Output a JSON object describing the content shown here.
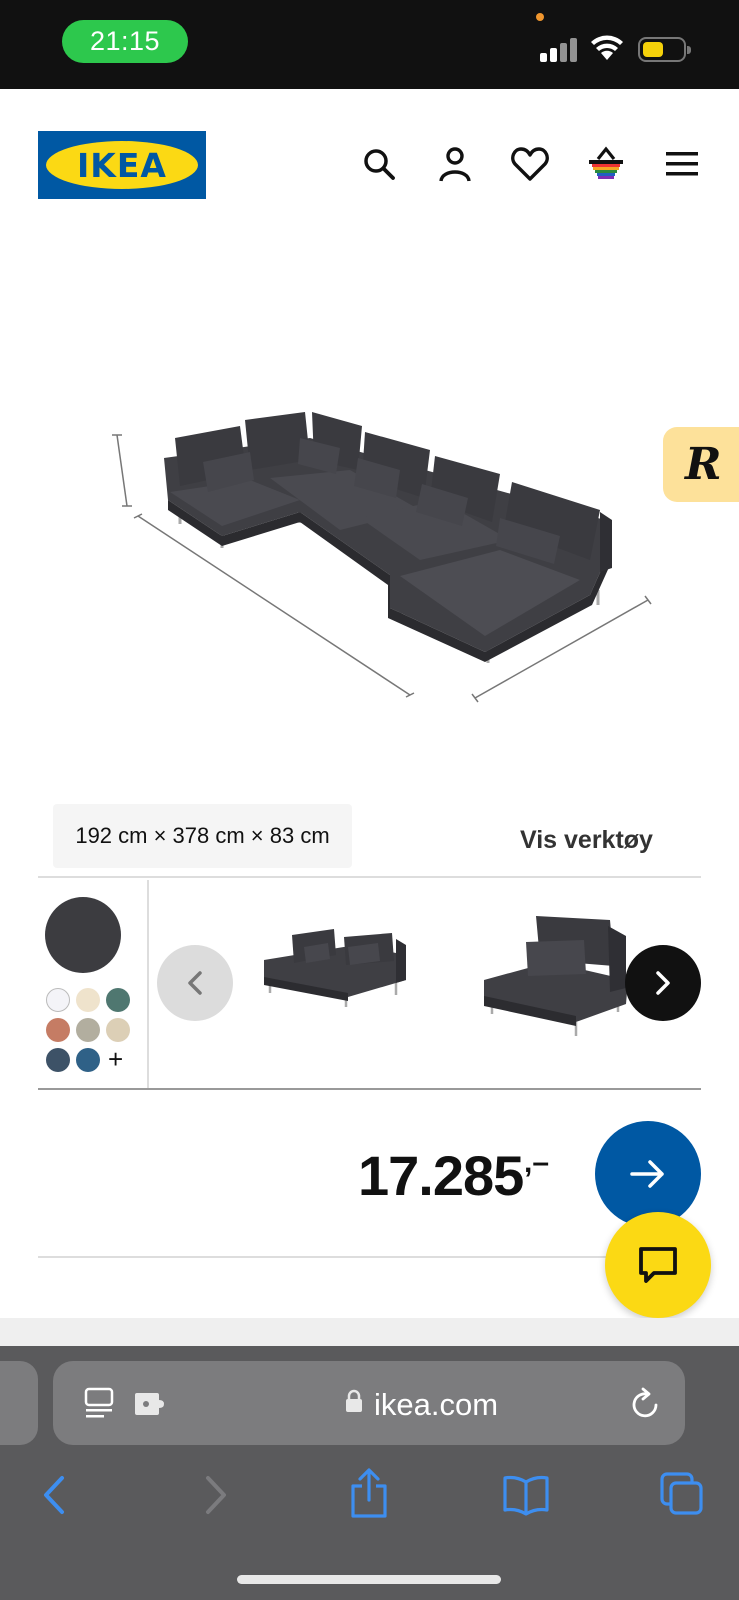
{
  "status_bar": {
    "time": "21:15",
    "icons": [
      "signal-icon",
      "wifi-icon",
      "battery-icon"
    ],
    "colors": {
      "time_pill": "#2dc84d",
      "battery_fill": "#f5d10a",
      "background": "#111111"
    }
  },
  "header": {
    "logo_text": "IKEA",
    "icons": [
      "search-icon",
      "account-icon",
      "heart-icon",
      "cart-icon",
      "menu-icon"
    ],
    "colors": {
      "logo_blue": "#0058a3",
      "logo_yellow": "#fbd914"
    }
  },
  "product": {
    "image": "sofa-image",
    "floating_badge": "R",
    "dimensions": "192 cm × 378 cm × 83 cm",
    "tools_link": "Vis verktøy"
  },
  "variants": {
    "selected_color": "#3c3c40",
    "swatches": [
      "#f4f4f8",
      "#efe3cc",
      "#4f7770",
      "#c57c64",
      "#b2ae9f",
      "#dccfb6",
      "#3d5267",
      "#2f6187"
    ],
    "more_label": "+",
    "thumbnails": [
      "sofa-module-two-seat",
      "sofa-module-one-seat"
    ],
    "nav": [
      "chevron-left-icon",
      "chevron-right-icon"
    ]
  },
  "pricing": {
    "price": "17.285",
    "suffix": ",–",
    "buy_icon": "arrow-right-icon",
    "chat_icon": "chat-icon",
    "colors": {
      "buy": "#0058a3",
      "chat": "#fbd914"
    }
  },
  "browser": {
    "url": "ikea.com",
    "icons": [
      "reader-icon",
      "extension-icon",
      "lock-icon",
      "reload-icon",
      "back-icon",
      "forward-icon",
      "share-icon",
      "bookmarks-icon",
      "tabs-icon"
    ],
    "accent": "#3d8ef0"
  }
}
